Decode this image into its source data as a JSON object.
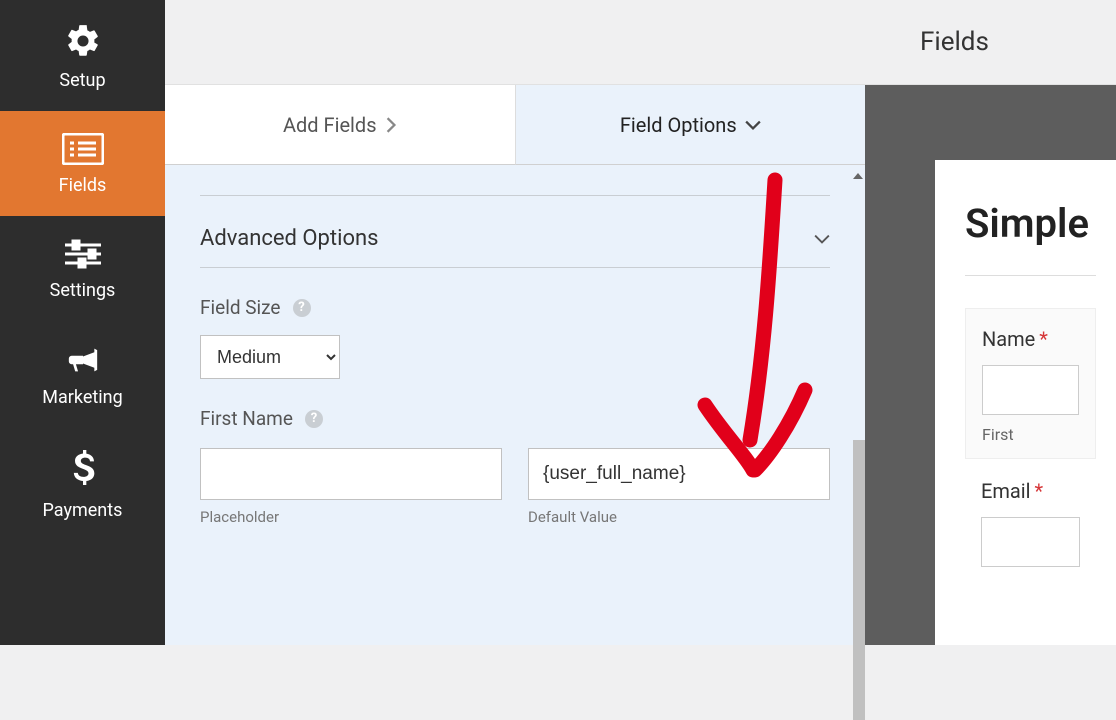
{
  "sidebar": {
    "items": [
      {
        "label": "Setup"
      },
      {
        "label": "Fields"
      },
      {
        "label": "Settings"
      },
      {
        "label": "Marketing"
      },
      {
        "label": "Payments"
      }
    ]
  },
  "tabs": {
    "add_fields": "Add Fields",
    "field_options": "Field Options"
  },
  "advanced": {
    "title": "Advanced Options",
    "field_size_label": "Field Size",
    "field_size_value": "Medium",
    "first_name_label": "First Name",
    "placeholder_value": "",
    "placeholder_caption": "Placeholder",
    "default_value": "{user_full_name}",
    "default_caption": "Default Value"
  },
  "right": {
    "header": "Fields",
    "form_title": "Simple",
    "name_label": "Name",
    "first_sub": "First",
    "email_label": "Email"
  }
}
